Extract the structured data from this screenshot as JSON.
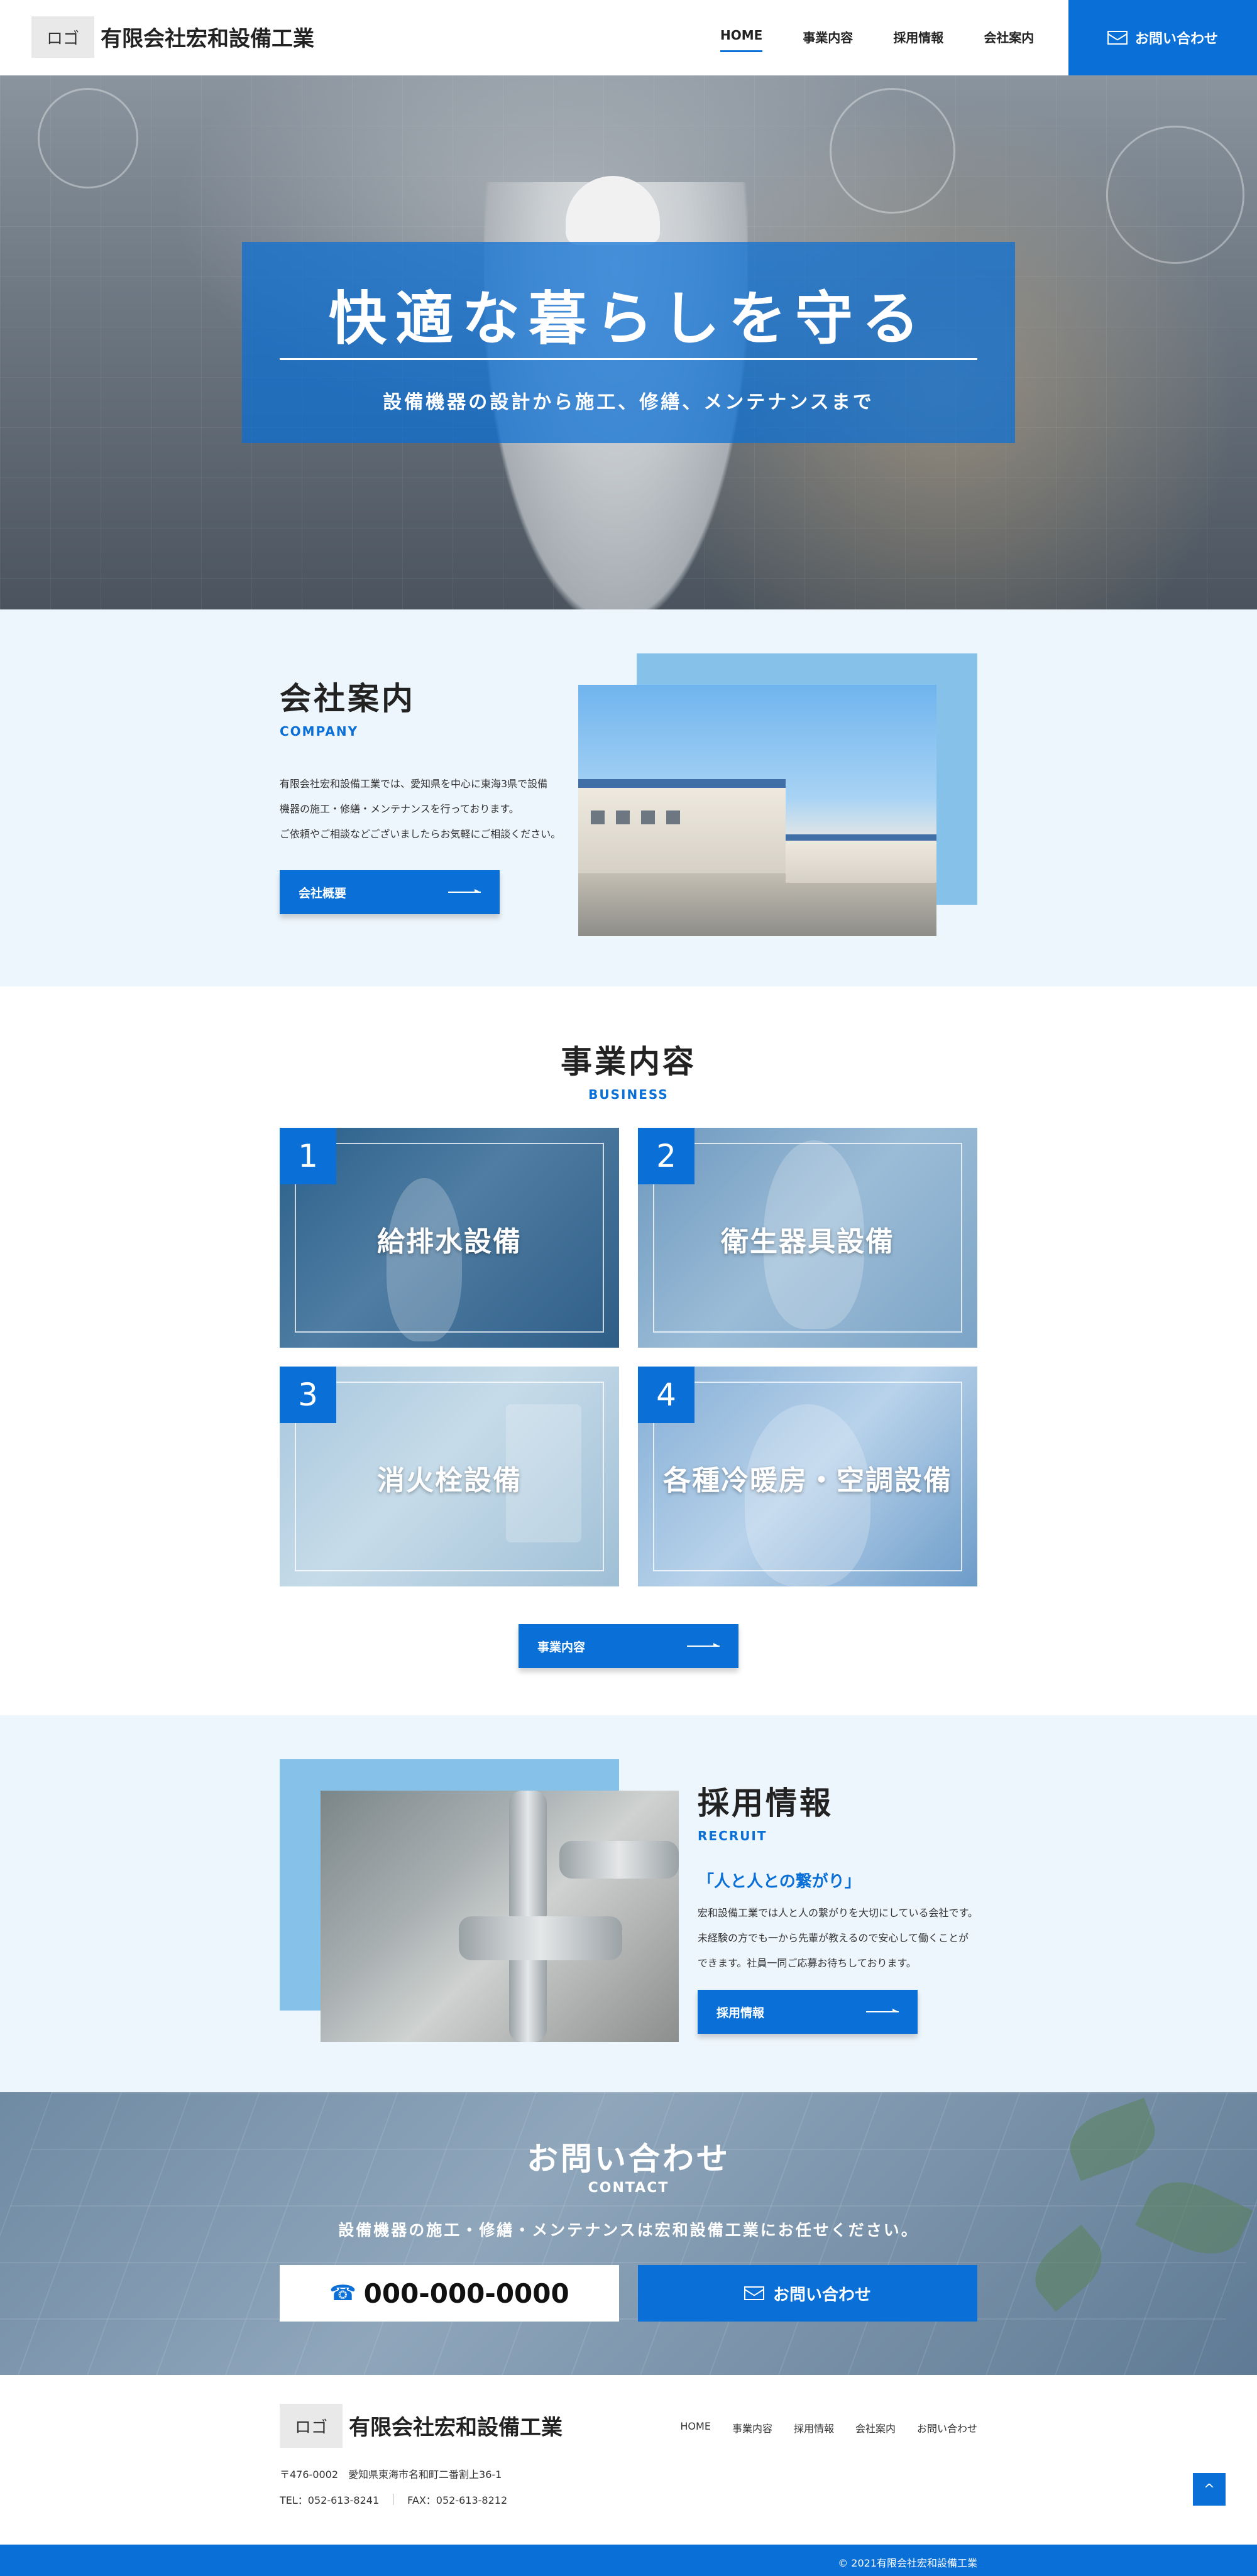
{
  "header": {
    "logo": "ロゴ",
    "company_name": "有限会社宏和設備工業",
    "nav": [
      {
        "label": "HOME",
        "active": true
      },
      {
        "label": "事業内容",
        "active": false
      },
      {
        "label": "採用情報",
        "active": false
      },
      {
        "label": "会社案内",
        "active": false
      }
    ],
    "contact_label": "お問い合わせ"
  },
  "hero": {
    "title": "快適な暮らしを守る",
    "subtitle": "設備機器の設計から施工、修繕、メンテナンスまで"
  },
  "company": {
    "title": "会社案内",
    "subtitle": "COMPANY",
    "body": [
      "有限会社宏和設備工業では、愛知県を中心に東海3県で設備",
      "機器の施工・修繕・メンテナンスを行っております。",
      "ご依頼やご相談などございましたらお気軽にご相談ください。"
    ],
    "button": "会社概要"
  },
  "business": {
    "title": "事業内容",
    "subtitle": "BUSINESS",
    "cards": [
      {
        "num": "1",
        "label": "給排水設備"
      },
      {
        "num": "2",
        "label": "衛生器具設備"
      },
      {
        "num": "3",
        "label": "消火栓設備"
      },
      {
        "num": "4",
        "label": "各種冷暖房・空調設備"
      }
    ],
    "button": "事業内容"
  },
  "recruit": {
    "title": "採用情報",
    "subtitle": "RECRUIT",
    "lead": "「人と人との繋がり」",
    "body": [
      "宏和設備工業では人と人の繋がりを大切にしている会社です。",
      "未経験の方でも一から先輩が教えるので安心して働くことが",
      "できます。社員一同ご応募お待ちしております。"
    ],
    "button": "採用情報"
  },
  "contact": {
    "title": "お問い合わせ",
    "subtitle": "CONTACT",
    "description": "設備機器の施工・修繕・メンテナンスは宏和設備工業にお任せください。",
    "tel": "000-000-0000",
    "mail_label": "お問い合わせ"
  },
  "footer": {
    "logo": "ロゴ",
    "company_name": "有限会社宏和設備工業",
    "nav": [
      "HOME",
      "事業内容",
      "採用情報",
      "会社案内",
      "お問い合わせ"
    ],
    "address": "〒476-0002　愛知県東海市名和町二番割上36-1",
    "tel": "TEL：052-613-8241",
    "fax": "FAX：052-613-8212",
    "pagetop": "^",
    "copyright": "© 2021有限会社宏和設備工業"
  },
  "colors": {
    "accent": "#0a6fd6",
    "light_bg": "#eef6fd",
    "photo_back": "#86c1ea"
  }
}
